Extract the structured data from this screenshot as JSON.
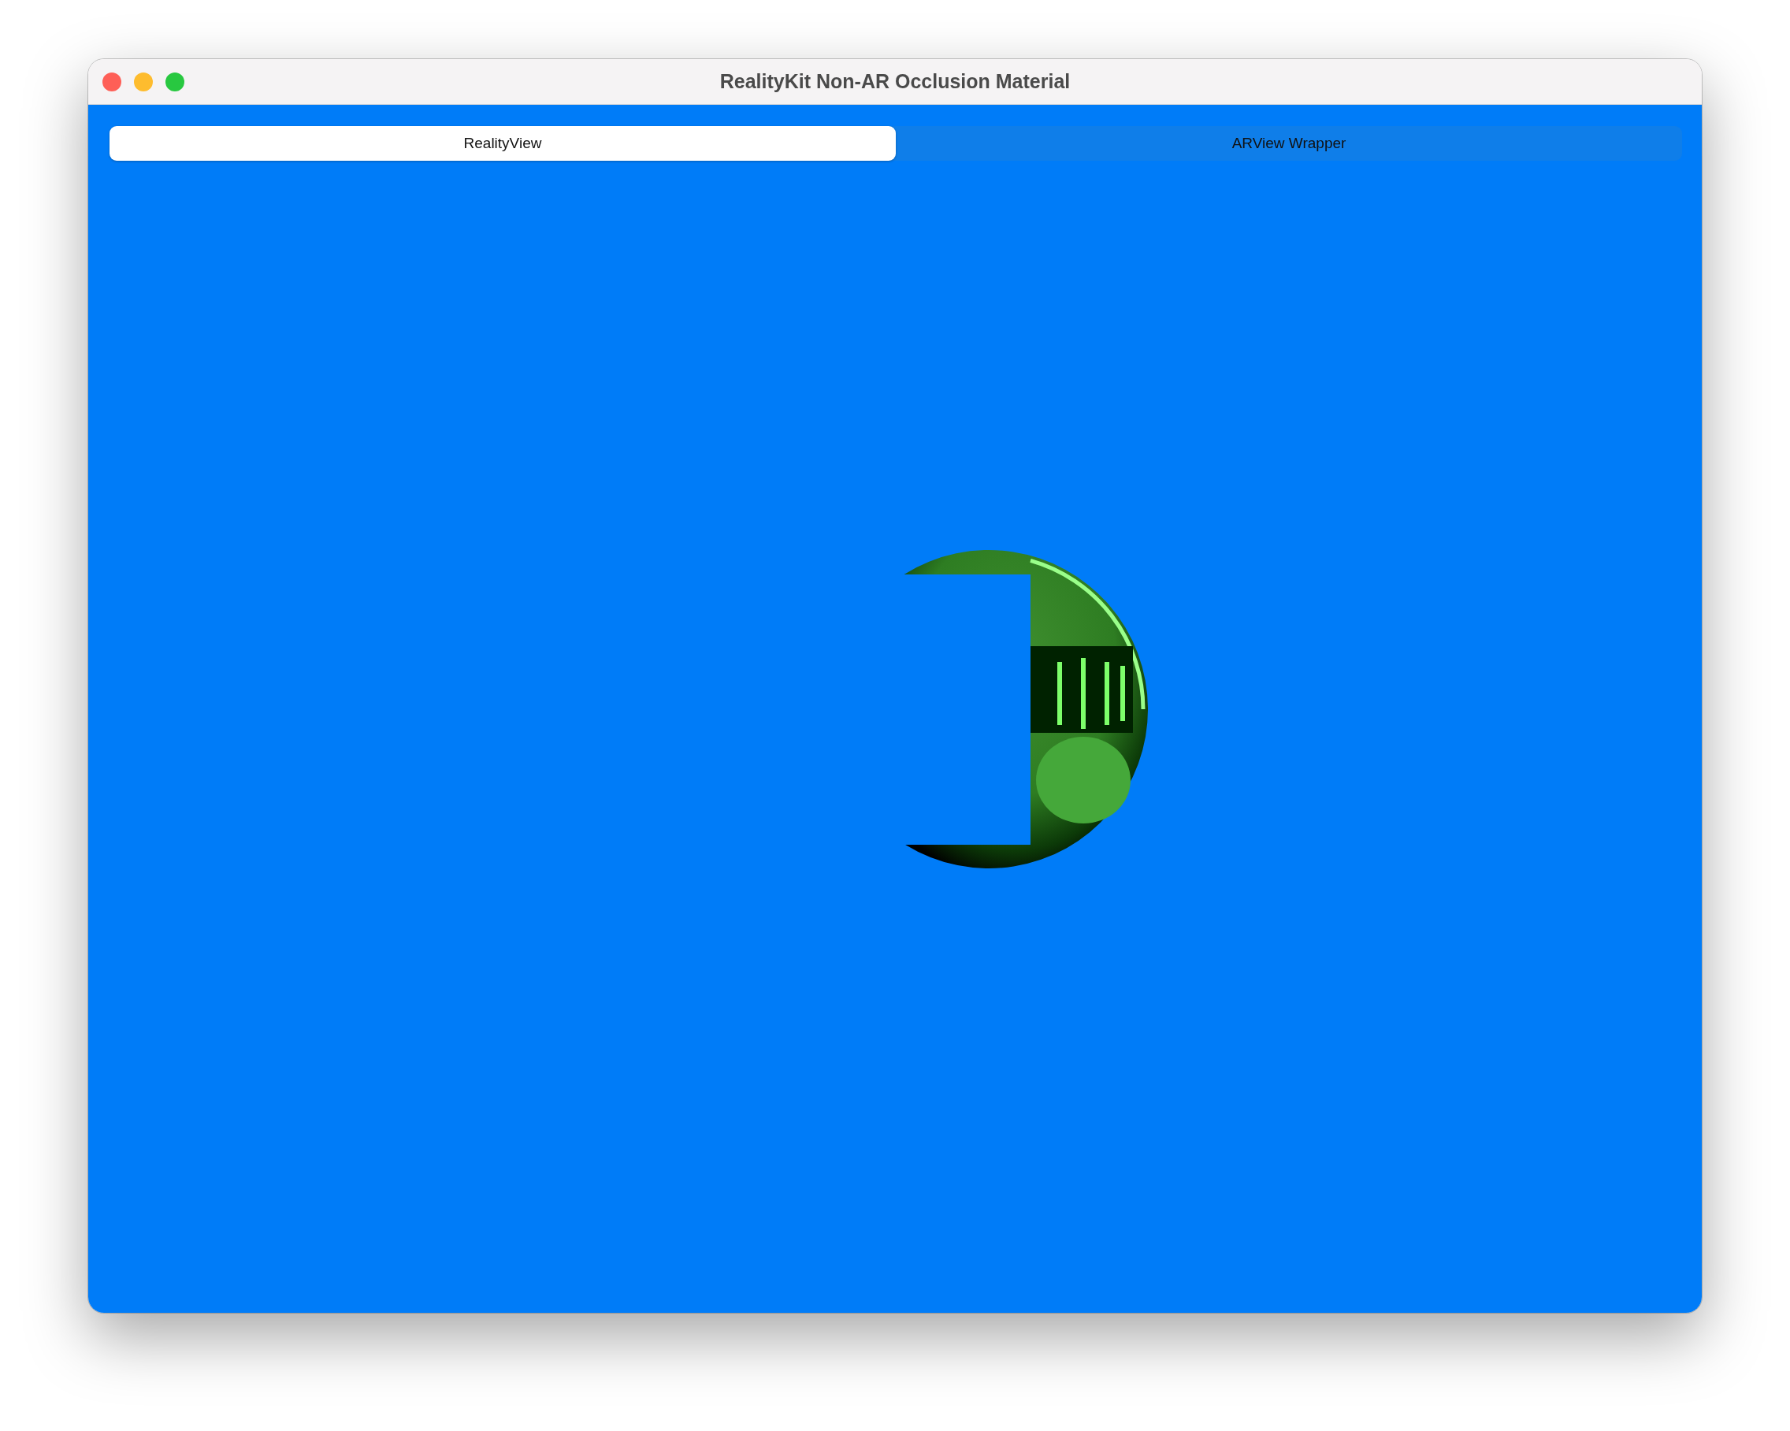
{
  "window": {
    "title": "RealityKit Non-AR Occlusion Material"
  },
  "tabs": [
    {
      "label": "RealityView",
      "selected": true
    },
    {
      "label": "ARView Wrapper",
      "selected": false
    }
  ]
}
